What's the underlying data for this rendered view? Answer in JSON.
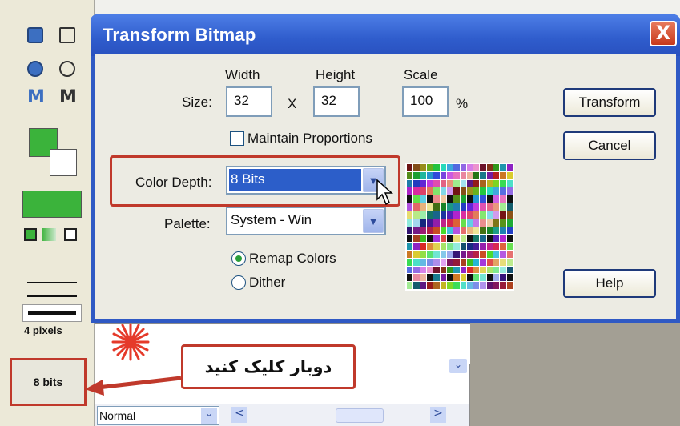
{
  "dialog": {
    "title": "Transform Bitmap",
    "close_label": "X",
    "size": {
      "label": "Size:",
      "width_label": "Width",
      "height_label": "Height",
      "scale_label": "Scale",
      "width_value": "32",
      "times": "X",
      "height_value": "32",
      "scale_value": "100",
      "percent": "%"
    },
    "maintain_proportions": "Maintain Proportions",
    "color_depth": {
      "label": "Color Depth:",
      "value": "8 Bits"
    },
    "palette": {
      "label": "Palette:",
      "value": "System - Win"
    },
    "remap_colors": "Remap Colors",
    "dither": "Dither",
    "buttons": {
      "transform": "Transform",
      "cancel": "Cancel",
      "help": "Help"
    }
  },
  "toolpanel": {
    "line_width": "4 pixels",
    "status": "8 bits"
  },
  "lower_panel": {
    "blend_mode": "Normal",
    "scroll_left": "<",
    "scroll_right": ">"
  },
  "annotation": {
    "callout_text": "دوبار کلیک کنید"
  },
  "colors": {
    "title_bar": "#2f5ccc",
    "highlight": "#c0392b",
    "selected": "#2c5ec9",
    "green_swatch": "#3bb33b"
  }
}
